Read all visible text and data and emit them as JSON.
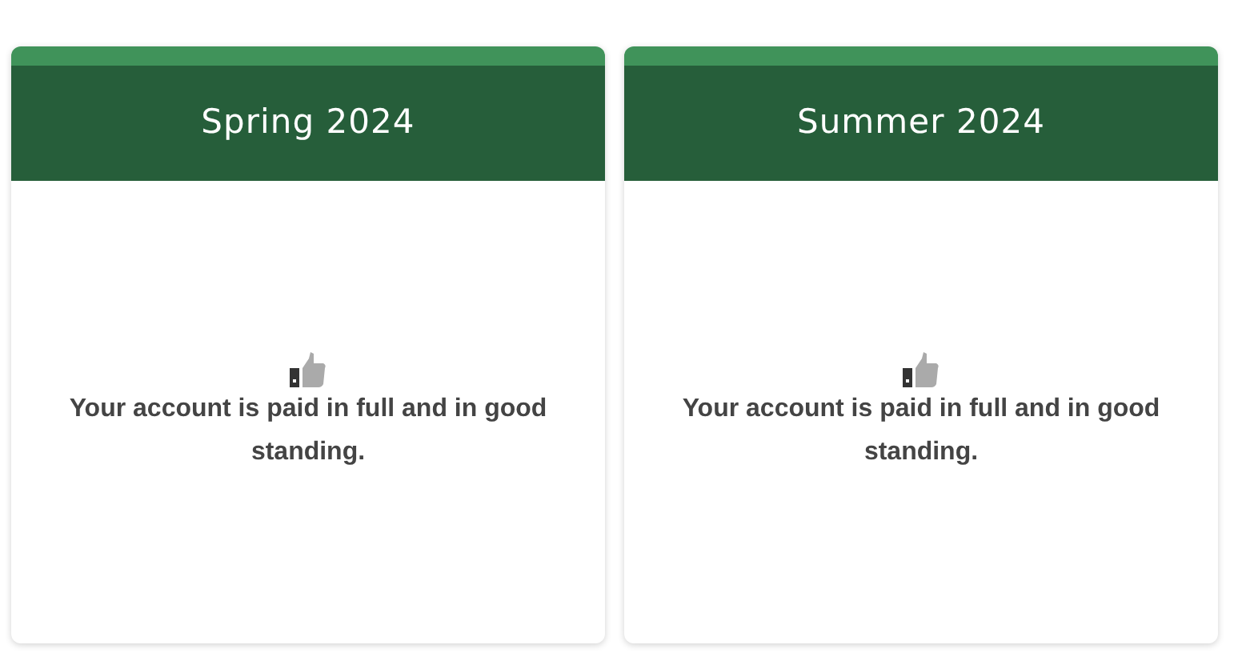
{
  "cards": [
    {
      "title": "Spring 2024",
      "message": "Your account is paid in full and in good standing."
    },
    {
      "title": "Summer 2024",
      "message": "Your account is paid in full and in good standing."
    }
  ]
}
